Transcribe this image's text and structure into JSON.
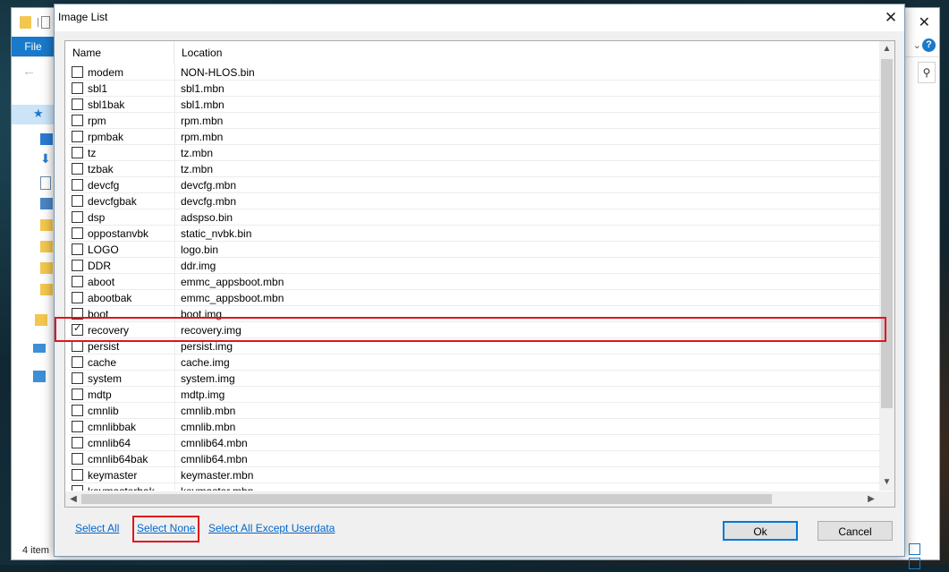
{
  "explorer": {
    "file_tab": "File",
    "status": "4 item",
    "close_glyph": "✕",
    "help_glyph": "?"
  },
  "dialog": {
    "title": "Image List",
    "close_glyph": "✕"
  },
  "list": {
    "columns": [
      "Name",
      "Location"
    ],
    "rows": [
      {
        "name": "modem",
        "location": "NON-HLOS.bin",
        "checked": false
      },
      {
        "name": "sbl1",
        "location": "sbl1.mbn",
        "checked": false
      },
      {
        "name": "sbl1bak",
        "location": "sbl1.mbn",
        "checked": false
      },
      {
        "name": "rpm",
        "location": "rpm.mbn",
        "checked": false
      },
      {
        "name": "rpmbak",
        "location": "rpm.mbn",
        "checked": false
      },
      {
        "name": "tz",
        "location": "tz.mbn",
        "checked": false
      },
      {
        "name": "tzbak",
        "location": "tz.mbn",
        "checked": false
      },
      {
        "name": "devcfg",
        "location": "devcfg.mbn",
        "checked": false
      },
      {
        "name": "devcfgbak",
        "location": "devcfg.mbn",
        "checked": false
      },
      {
        "name": "dsp",
        "location": "adspso.bin",
        "checked": false
      },
      {
        "name": "oppostanvbk",
        "location": "static_nvbk.bin",
        "checked": false
      },
      {
        "name": "LOGO",
        "location": "logo.bin",
        "checked": false
      },
      {
        "name": "DDR",
        "location": "ddr.img",
        "checked": false
      },
      {
        "name": "aboot",
        "location": "emmc_appsboot.mbn",
        "checked": false
      },
      {
        "name": "abootbak",
        "location": "emmc_appsboot.mbn",
        "checked": false
      },
      {
        "name": "boot",
        "location": "boot.img",
        "checked": false
      },
      {
        "name": "recovery",
        "location": "recovery.img",
        "checked": true
      },
      {
        "name": "persist",
        "location": "persist.img",
        "checked": false
      },
      {
        "name": "cache",
        "location": "cache.img",
        "checked": false
      },
      {
        "name": "system",
        "location": "system.img",
        "checked": false
      },
      {
        "name": "mdtp",
        "location": "mdtp.img",
        "checked": false
      },
      {
        "name": "cmnlib",
        "location": "cmnlib.mbn",
        "checked": false
      },
      {
        "name": "cmnlibbak",
        "location": "cmnlib.mbn",
        "checked": false
      },
      {
        "name": "cmnlib64",
        "location": "cmnlib64.mbn",
        "checked": false
      },
      {
        "name": "cmnlib64bak",
        "location": "cmnlib64.mbn",
        "checked": false
      },
      {
        "name": "keymaster",
        "location": "keymaster.mbn",
        "checked": false
      },
      {
        "name": "keymasterbak",
        "location": "keymaster.mbn",
        "checked": false
      }
    ]
  },
  "links": {
    "select_all": "Select All",
    "select_none": "Select None",
    "select_except": "Select All Except Userdata"
  },
  "buttons": {
    "ok": "Ok",
    "cancel": "Cancel"
  },
  "colors": {
    "highlight": "#e0141e",
    "link": "#0066cc",
    "accent": "#0078d7"
  },
  "icons": {
    "check": "✓",
    "scroll_up": "▲",
    "scroll_down": "▼",
    "scroll_left": "◀",
    "scroll_right": "▶"
  }
}
